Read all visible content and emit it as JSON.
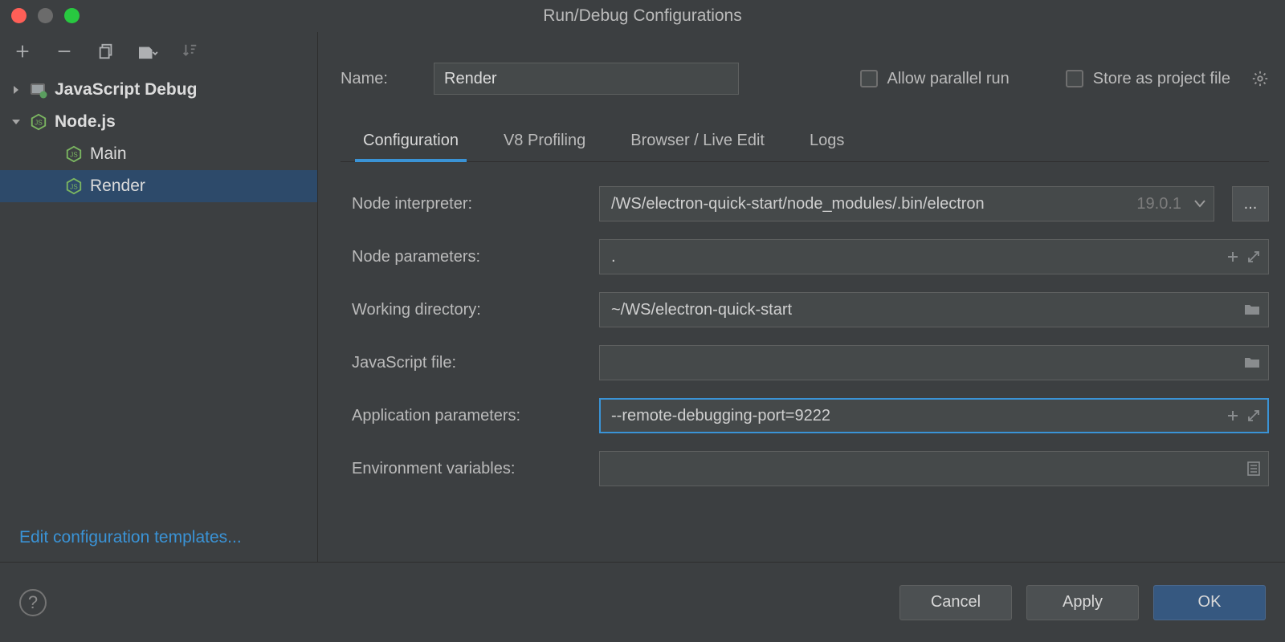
{
  "title": "Run/Debug Configurations",
  "sidebar": {
    "edit_templates": "Edit configuration templates...",
    "tree": [
      {
        "label": "JavaScript Debug",
        "expanded": false,
        "bold": true
      },
      {
        "label": "Node.js",
        "expanded": true,
        "bold": true,
        "children": [
          {
            "label": "Main",
            "selected": false
          },
          {
            "label": "Render",
            "selected": true
          }
        ]
      }
    ]
  },
  "name": {
    "label": "Name:",
    "value": "Render"
  },
  "checkboxes": {
    "parallel": "Allow parallel run",
    "store": "Store as project file"
  },
  "tabs": [
    "Configuration",
    "V8 Profiling",
    "Browser / Live Edit",
    "Logs"
  ],
  "activeTab": 0,
  "fields": {
    "interpreter": {
      "label": "Node interpreter:",
      "value": "/WS/electron-quick-start/node_modules/.bin/electron",
      "version": "19.0.1"
    },
    "nodeParams": {
      "label": "Node parameters:",
      "value": "."
    },
    "workingDir": {
      "label": "Working directory:",
      "value": "~/WS/electron-quick-start"
    },
    "jsFile": {
      "label": "JavaScript file:",
      "value": ""
    },
    "appParams": {
      "label": "Application parameters:",
      "value": "--remote-debugging-port=9222"
    },
    "envVars": {
      "label": "Environment variables:",
      "value": ""
    }
  },
  "buttons": {
    "cancel": "Cancel",
    "apply": "Apply",
    "ok": "OK",
    "ext": "..."
  }
}
